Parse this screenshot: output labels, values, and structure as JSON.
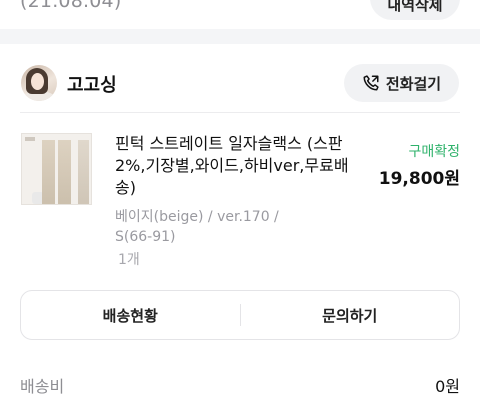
{
  "prev_order": {
    "date": "(21.08.04)",
    "delete_label": "내역삭제"
  },
  "store": {
    "name": "고고싱",
    "call_label": "전화걸기",
    "call_icon": "phone-icon"
  },
  "product": {
    "name": "핀턱 스트레이트 일자슬랙스 (스판2%,기장별,와이드,하비ver,무료배송)",
    "status": "구매확정",
    "price": "19,800원",
    "option": "베이지(beige) / ver.170 / S(66-91)",
    "quantity": "1개"
  },
  "actions": {
    "tracking_label": "배송현황",
    "inquiry_label": "문의하기"
  },
  "shipping": {
    "label": "배송비",
    "value": "0원"
  },
  "colors": {
    "background": "#f4f5f7",
    "status_green": "#2fb26b",
    "muted_text": "#8e8e93"
  }
}
